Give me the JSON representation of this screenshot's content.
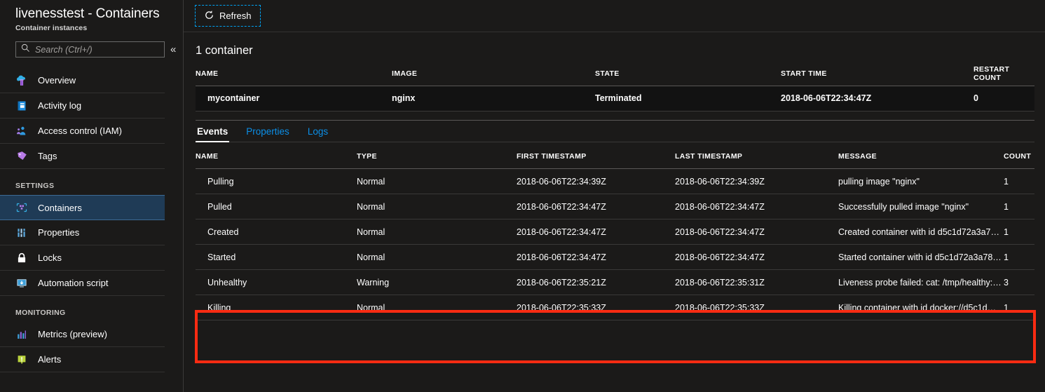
{
  "blade": {
    "title": "livenesstest - Containers",
    "subtitle": "Container instances"
  },
  "search": {
    "placeholder": "Search (Ctrl+/)",
    "value": "",
    "collapse_glyph": "«"
  },
  "sidebar": {
    "items": [
      {
        "label": "Overview",
        "icon": "cloud-pillar-icon",
        "selected": false
      },
      {
        "label": "Activity log",
        "icon": "activity-log-icon",
        "selected": false
      },
      {
        "label": "Access control (IAM)",
        "icon": "access-control-icon",
        "selected": false
      },
      {
        "label": "Tags",
        "icon": "tag-icon",
        "selected": false
      }
    ],
    "settings_header": "SETTINGS",
    "settings_items": [
      {
        "label": "Containers",
        "icon": "containers-icon",
        "selected": true
      },
      {
        "label": "Properties",
        "icon": "properties-icon",
        "selected": false
      },
      {
        "label": "Locks",
        "icon": "lock-icon",
        "selected": false
      },
      {
        "label": "Automation script",
        "icon": "automation-script-icon",
        "selected": false
      }
    ],
    "monitoring_header": "MONITORING",
    "monitoring_items": [
      {
        "label": "Metrics (preview)",
        "icon": "metrics-chart-icon",
        "selected": false
      },
      {
        "label": "Alerts",
        "icon": "alert-icon",
        "selected": false
      }
    ]
  },
  "toolbar": {
    "refresh_label": "Refresh",
    "refresh_icon": "refresh-icon"
  },
  "containers_section": {
    "title": "1 container",
    "columns": [
      "NAME",
      "IMAGE",
      "STATE",
      "START TIME",
      "RESTART COUNT"
    ],
    "rows": [
      {
        "name": "mycontainer",
        "image": "nginx",
        "state": "Terminated",
        "start_time": "2018-06-06T22:34:47Z",
        "restart_count": "0"
      }
    ]
  },
  "tabs": [
    {
      "label": "Events",
      "active": true
    },
    {
      "label": "Properties",
      "active": false
    },
    {
      "label": "Logs",
      "active": false
    }
  ],
  "events_section": {
    "columns": [
      "NAME",
      "TYPE",
      "FIRST TIMESTAMP",
      "LAST TIMESTAMP",
      "MESSAGE",
      "COUNT"
    ],
    "rows": [
      {
        "name": "Pulling",
        "type": "Normal",
        "first_timestamp": "2018-06-06T22:34:39Z",
        "last_timestamp": "2018-06-06T22:34:39Z",
        "message": "pulling image \"nginx\"",
        "count": "1",
        "highlighted": false
      },
      {
        "name": "Pulled",
        "type": "Normal",
        "first_timestamp": "2018-06-06T22:34:47Z",
        "last_timestamp": "2018-06-06T22:34:47Z",
        "message": "Successfully pulled image \"nginx\"",
        "count": "1",
        "highlighted": false
      },
      {
        "name": "Created",
        "type": "Normal",
        "first_timestamp": "2018-06-06T22:34:47Z",
        "last_timestamp": "2018-06-06T22:34:47Z",
        "message": "Created container with id d5c1d72a3a7…",
        "count": "1",
        "highlighted": false
      },
      {
        "name": "Started",
        "type": "Normal",
        "first_timestamp": "2018-06-06T22:34:47Z",
        "last_timestamp": "2018-06-06T22:34:47Z",
        "message": "Started container with id d5c1d72a3a78…",
        "count": "1",
        "highlighted": false
      },
      {
        "name": "Unhealthy",
        "type": "Warning",
        "first_timestamp": "2018-06-06T22:35:21Z",
        "last_timestamp": "2018-06-06T22:35:31Z",
        "message": "Liveness probe failed: cat: /tmp/healthy:…",
        "count": "3",
        "highlighted": true
      },
      {
        "name": "Killing",
        "type": "Normal",
        "first_timestamp": "2018-06-06T22:35:33Z",
        "last_timestamp": "2018-06-06T22:35:33Z",
        "message": "Killing container with id docker://d5c1d…",
        "count": "1",
        "highlighted": true
      }
    ]
  },
  "annotation": {
    "highlight_color": "#fb2b12"
  },
  "colors": {
    "background": "#1b1a19",
    "row_alt": "#121212",
    "selected_nav": "#1f3b56",
    "link": "#0b8fe8",
    "focus_outline": "#00a2f3"
  }
}
